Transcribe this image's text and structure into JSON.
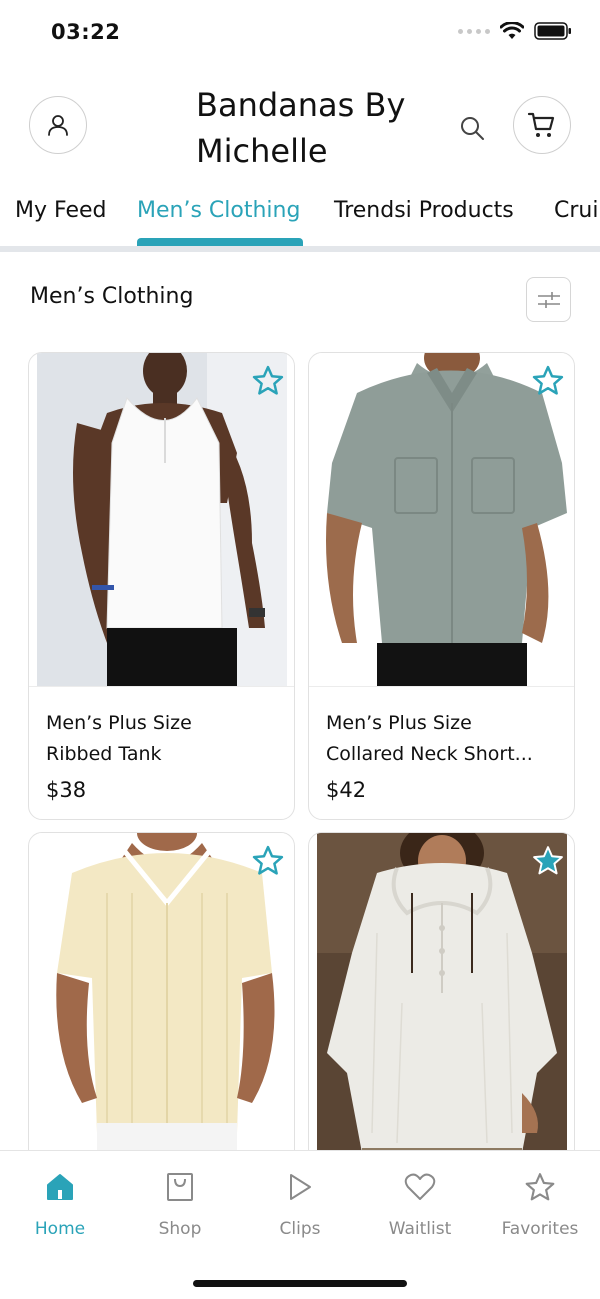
{
  "status_bar": {
    "time": "03:22"
  },
  "header": {
    "shop_name_line1": "Bandanas By",
    "shop_name_line2": "Michelle"
  },
  "tabs": [
    {
      "label": "My Feed",
      "active": false
    },
    {
      "label": "Men’s Clothing",
      "active": true
    },
    {
      "label": "Trendsi Products",
      "active": false
    },
    {
      "label": "Crui",
      "active": false
    }
  ],
  "section": {
    "title": "Men’s Clothing"
  },
  "products": [
    {
      "name_line1": "Men’s Plus Size",
      "name_line2": "Ribbed Tank",
      "price": "$38",
      "favorited": false
    },
    {
      "name_line1": "Men’s Plus Size",
      "name_line2": "Collared Neck Short...",
      "price": "$42",
      "favorited": false
    },
    {
      "name_line1": "",
      "name_line2": "",
      "price": "",
      "favorited": false
    },
    {
      "name_line1": "",
      "name_line2": "",
      "price": "",
      "favorited": true
    }
  ],
  "bottom_nav": [
    {
      "label": "Home",
      "icon": "home-icon",
      "active": true
    },
    {
      "label": "Shop",
      "icon": "shopping-bag-icon",
      "active": false
    },
    {
      "label": "Clips",
      "icon": "play-icon",
      "active": false
    },
    {
      "label": "Waitlist",
      "icon": "heart-icon",
      "active": false
    },
    {
      "label": "Favorites",
      "icon": "star-icon",
      "active": false
    }
  ],
  "colors": {
    "accent": "#2aa3b8",
    "inactive": "#8a8a8a",
    "text": "#111111"
  }
}
